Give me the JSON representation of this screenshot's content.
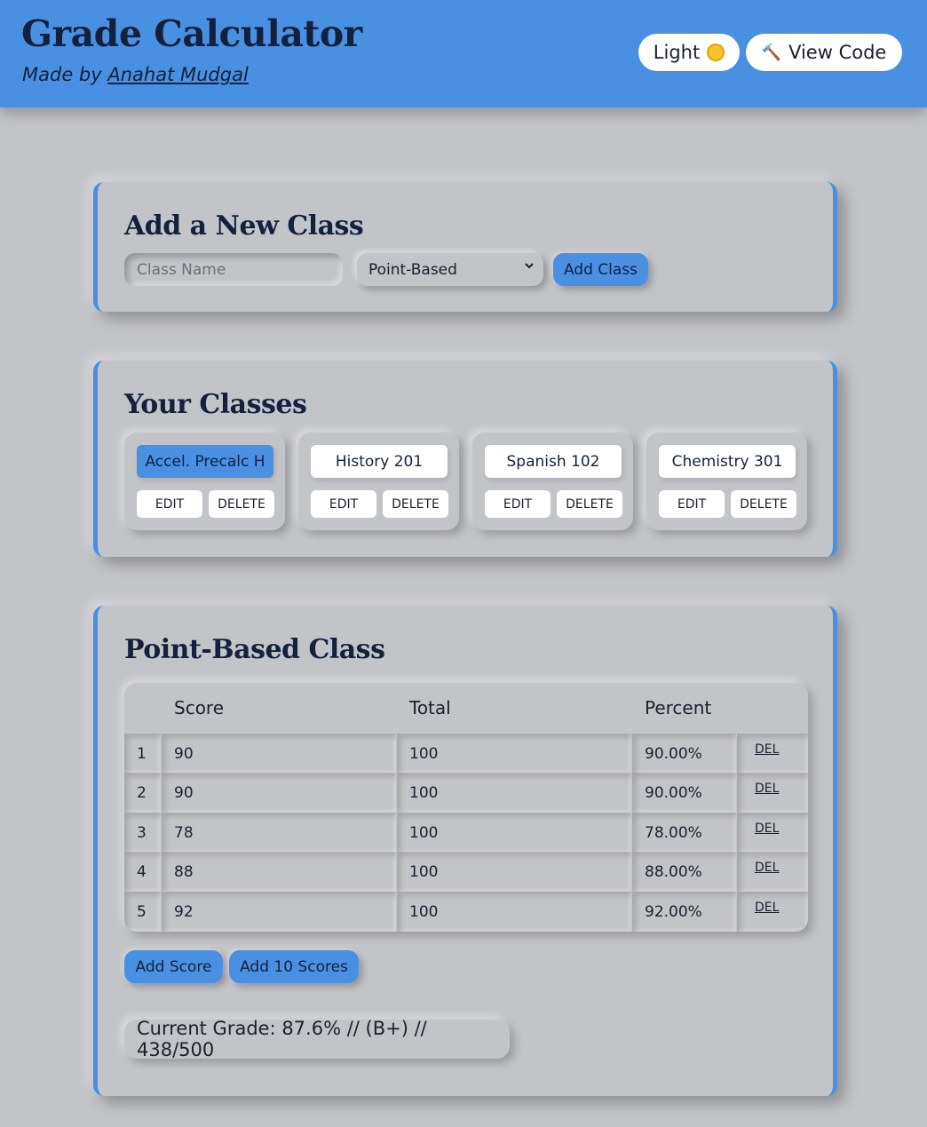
{
  "header": {
    "title": "Grade Calculator",
    "byline_prefix": "Made by",
    "author": "Anahat Mudgal",
    "theme_label": "Light",
    "code_label": "View Code"
  },
  "add_class": {
    "title": "Add a New Class",
    "name_placeholder": "Class Name",
    "type_selected": "Point-Based",
    "submit_label": "Add Class"
  },
  "classes": {
    "title": "Your Classes",
    "edit_label": "EDIT",
    "delete_label": "DELETE",
    "items": [
      {
        "name": "Accel. Precalc H",
        "active": true
      },
      {
        "name": "History 201",
        "active": false
      },
      {
        "name": "Spanish 102",
        "active": false
      },
      {
        "name": "Chemistry 301",
        "active": false
      }
    ]
  },
  "point_class": {
    "title": "Point-Based Class",
    "columns": [
      "Score",
      "Total",
      "Percent"
    ],
    "del_label": "DEL",
    "rows": [
      {
        "index": "1",
        "score": "90",
        "total": "100",
        "percent": "90.00%"
      },
      {
        "index": "2",
        "score": "90",
        "total": "100",
        "percent": "90.00%"
      },
      {
        "index": "3",
        "score": "78",
        "total": "100",
        "percent": "78.00%"
      },
      {
        "index": "4",
        "score": "88",
        "total": "100",
        "percent": "88.00%"
      },
      {
        "index": "5",
        "score": "92",
        "total": "100",
        "percent": "92.00%"
      }
    ],
    "add_score_label": "Add Score",
    "add_ten_label": "Add 10 Scores",
    "current_grade": "Current Grade: 87.6% // (B+) // 438/500"
  },
  "colors": {
    "accent": "#4a90e2",
    "background": "#c3c4c8",
    "text": "#14213d"
  },
  "icons": {
    "theme": "sun-icon",
    "code": "hammer-icon",
    "select": "chevron-down-icon"
  }
}
